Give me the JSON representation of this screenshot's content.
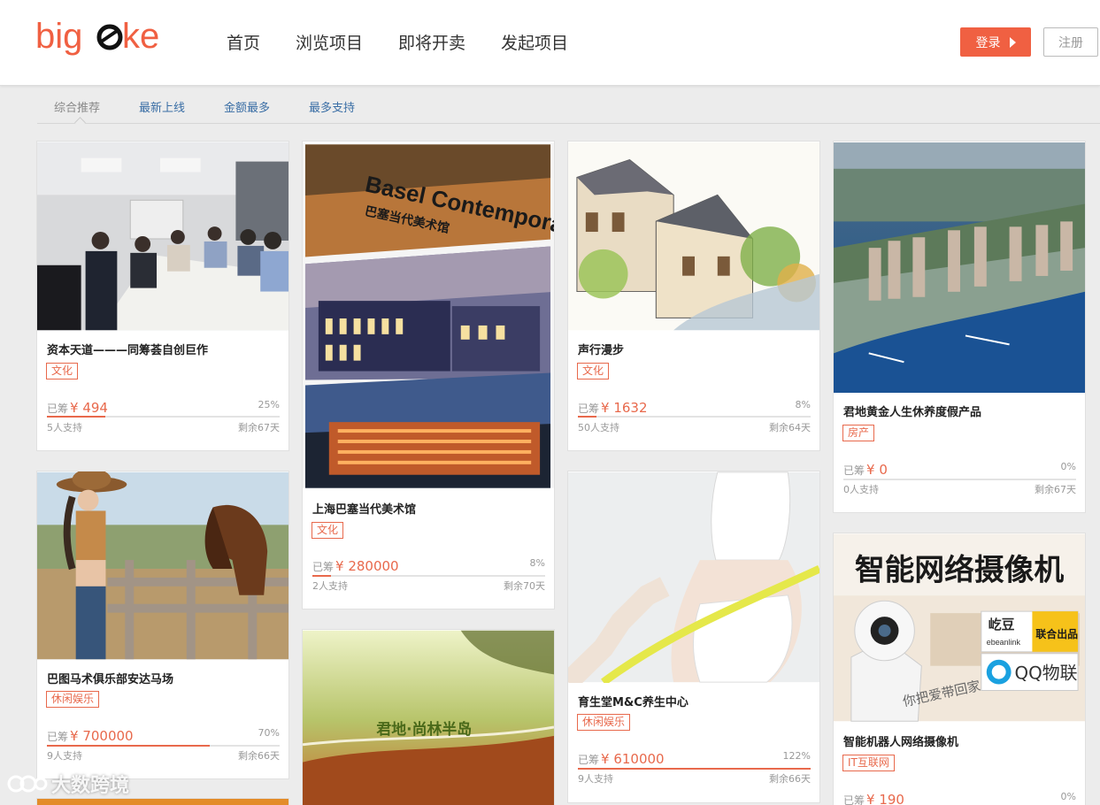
{
  "brand": {
    "logo_text": "bigeke",
    "accent": "#f06042"
  },
  "nav": {
    "items": [
      "首页",
      "浏览项目",
      "即将开卖",
      "发起项目"
    ]
  },
  "auth": {
    "login": "登录",
    "register": "注册"
  },
  "sort_tabs": [
    "综合推荐",
    "最新上线",
    "金额最多",
    "最多支持"
  ],
  "labels": {
    "raised": "已筹"
  },
  "projects": [
    {
      "title": "资本天道———同筹荟自创巨作",
      "tag": "文化",
      "raised": "¥ 494",
      "percent": "25%",
      "progress": 0.25,
      "supporters": "5人支持",
      "days_left": "剩余67天"
    },
    {
      "title": "上海巴塞当代美术馆",
      "tag": "文化",
      "raised": "¥ 280000",
      "percent": "8%",
      "progress": 0.08,
      "supporters": "2人支持",
      "days_left": "剩余70天"
    },
    {
      "title": "声行漫步",
      "tag": "文化",
      "raised": "¥ 1632",
      "percent": "8%",
      "progress": 0.08,
      "supporters": "50人支持",
      "days_left": "剩余64天"
    },
    {
      "title": "君地黄金人生休养度假产品",
      "tag": "房产",
      "raised": "¥ 0",
      "percent": "0%",
      "progress": 0,
      "supporters": "0人支持",
      "days_left": "剩余67天"
    },
    {
      "title": "巴图马术俱乐部安达马场",
      "tag": "休闲娱乐",
      "raised": "¥ 700000",
      "percent": "70%",
      "progress": 0.7,
      "supporters": "9人支持",
      "days_left": "剩余66天"
    },
    {
      "title": "育生堂M&C养生中心",
      "tag": "休闲娱乐",
      "raised": "¥ 610000",
      "percent": "122%",
      "progress": 1,
      "supporters": "9人支持",
      "days_left": "剩余66天"
    },
    {
      "title": "智能机器人网络摄像机",
      "tag": "IT互联网",
      "raised": "¥ 190",
      "percent": "0%",
      "progress": 0
    }
  ],
  "image_text": {
    "basel_sign": "Basel Contemporary Art",
    "basel_cn": "巴塞当代美术馆",
    "camera_headline": "智能网络摄像机",
    "camera_brand": "屹豆",
    "camera_brand_en": "ebeanlink",
    "camera_joint": "联合出品",
    "camera_qq": "QQ物联",
    "camera_script": "你把爱带回家",
    "beach_text": "君地·尚林半岛"
  },
  "watermark": "大数跨境"
}
